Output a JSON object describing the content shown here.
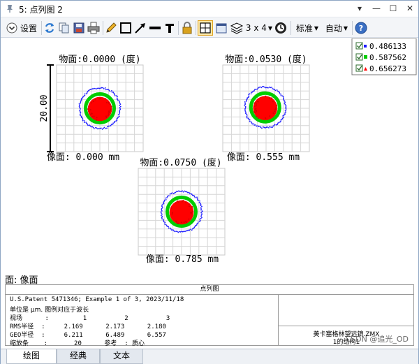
{
  "window": {
    "title": "5: 点列图 2",
    "controls": [
      "▾",
      "—",
      "☐",
      "✕"
    ]
  },
  "toolbar": {
    "settings_label": "设置",
    "layout_label": "3 x 4",
    "standard_label": "标准",
    "auto_label": "自动"
  },
  "legend": {
    "items": [
      {
        "label": "0.486133",
        "color": "#1a1aff"
      },
      {
        "label": "0.587562",
        "color": "#00cc00"
      },
      {
        "label": "0.656273",
        "color": "#ff0000"
      }
    ]
  },
  "chart_data": [
    {
      "type": "scatter",
      "title": "物面:0.0000 (度)",
      "xlabel": "像面: 0.000 mm",
      "scale_label": "20.00",
      "series": [
        {
          "name": "0.486133",
          "rms_radius": 2.169,
          "geo_radius": 6.211
        },
        {
          "name": "0.587562",
          "rms_radius": 2.173,
          "geo_radius": 6.489
        },
        {
          "name": "0.656273",
          "rms_radius": 2.18,
          "geo_radius": 6.557
        }
      ]
    },
    {
      "type": "scatter",
      "title": "物面:0.0530 (度)",
      "xlabel": "像面: 0.555 mm"
    },
    {
      "type": "scatter",
      "title": "物面:0.0750 (度)",
      "xlabel": "像面: 0.785 mm"
    }
  ],
  "plot": {
    "surface_label": "面: 像面"
  },
  "info": {
    "header": "点列图",
    "line1": "U.S.Patent 5471346; Example 1 of 3, 2023/11/18",
    "line2": "单位是 μm. 图例对应于波长",
    "line3": "视场      :         1          2          3",
    "line4": "RMS半径  :     2.169      2.173      2.180",
    "line5": "GEO半径  :     6.211      6.489      6.557",
    "line6": "缩放条    :       20      参考  : 质心",
    "file": "美卡塞格林望远镜.ZMX",
    "config": "1的结构1"
  },
  "tabs": [
    "绘图",
    "经典",
    "文本"
  ],
  "watermark": "CSDN @追光_OD"
}
